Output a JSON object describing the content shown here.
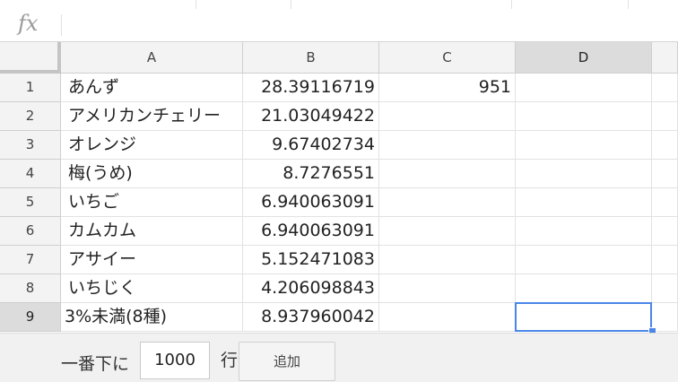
{
  "formula_bar": {
    "fx_label": "fx",
    "value": ""
  },
  "columns": [
    "A",
    "B",
    "C",
    "D"
  ],
  "rows": [
    {
      "n": "1",
      "a": "あんず",
      "b": "28.39116719",
      "c": "951",
      "d": ""
    },
    {
      "n": "2",
      "a": "アメリカンチェリー",
      "b": "21.03049422",
      "c": "",
      "d": ""
    },
    {
      "n": "3",
      "a": "オレンジ",
      "b": "9.67402734",
      "c": "",
      "d": ""
    },
    {
      "n": "4",
      "a": "梅(うめ)",
      "b": "8.7276551",
      "c": "",
      "d": ""
    },
    {
      "n": "5",
      "a": "いちご",
      "b": "6.940063091",
      "c": "",
      "d": ""
    },
    {
      "n": "6",
      "a": "カムカム",
      "b": "6.940063091",
      "c": "",
      "d": ""
    },
    {
      "n": "7",
      "a": "アサイー",
      "b": "5.152471083",
      "c": "",
      "d": ""
    },
    {
      "n": "8",
      "a": "いちじく",
      "b": "4.206098843",
      "c": "",
      "d": ""
    },
    {
      "n": "9",
      "a": "3%未満(8種)",
      "b": "8.937960042",
      "c": "",
      "d": ""
    }
  ],
  "selected_cell": "D9",
  "footer": {
    "prefix": "一番下に",
    "row_count": "1000",
    "suffix": "行",
    "add_button": "追加"
  }
}
